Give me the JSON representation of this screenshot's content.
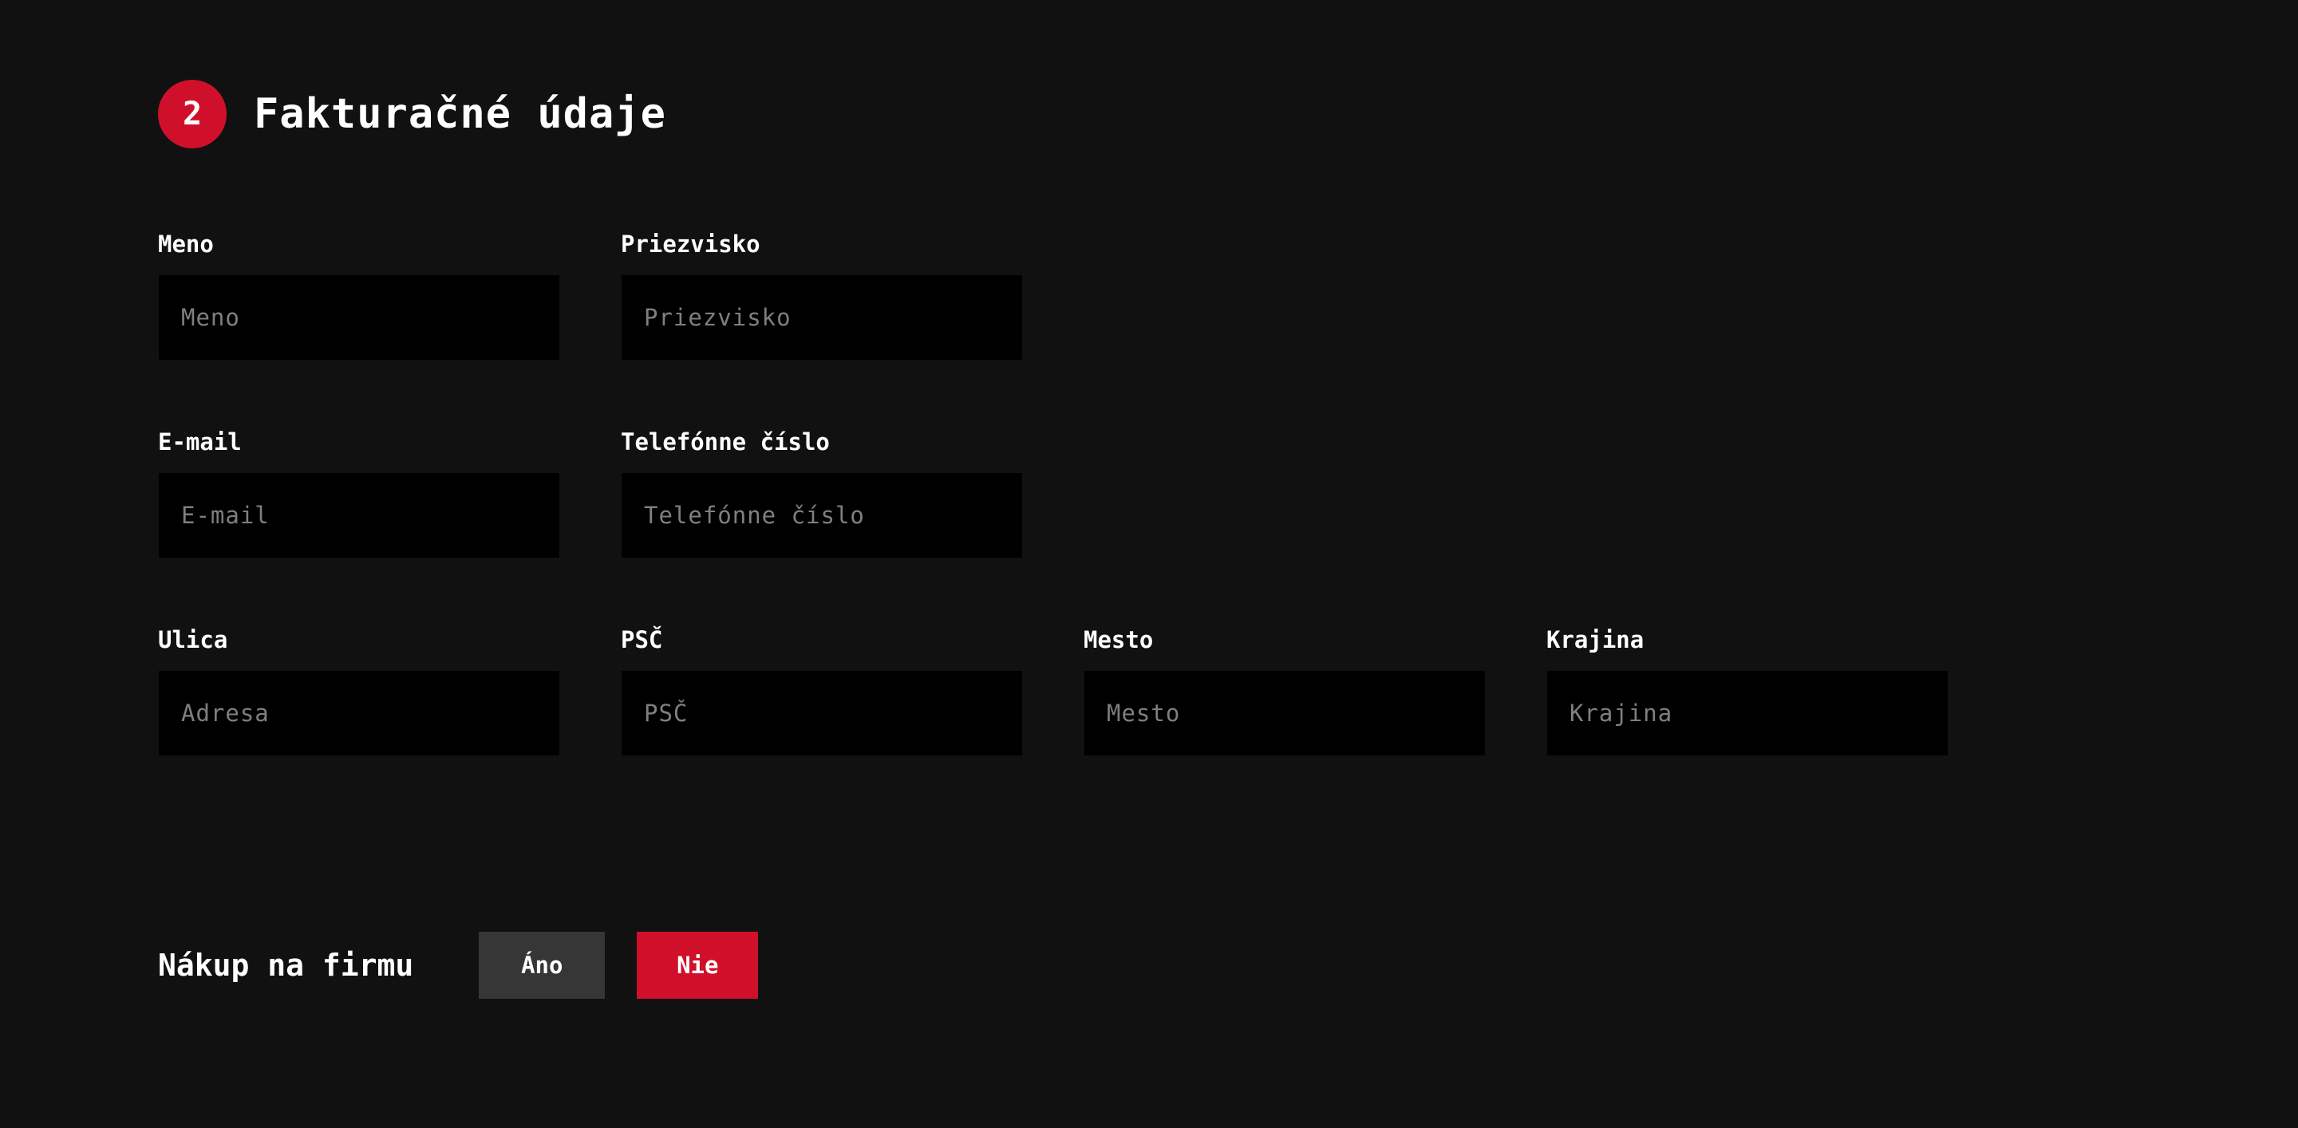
{
  "section": {
    "step_number": "2",
    "title": "Fakturačné údaje"
  },
  "fields": {
    "first_name": {
      "label": "Meno",
      "placeholder": "Meno",
      "value": ""
    },
    "last_name": {
      "label": "Priezvisko",
      "placeholder": "Priezvisko",
      "value": ""
    },
    "email": {
      "label": "E-mail",
      "placeholder": "E-mail",
      "value": ""
    },
    "phone": {
      "label": "Telefónne číslo",
      "placeholder": "Telefónne číslo",
      "value": ""
    },
    "street": {
      "label": "Ulica",
      "placeholder": "Adresa",
      "value": ""
    },
    "zip": {
      "label": "PSČ",
      "placeholder": "PSČ",
      "value": ""
    },
    "city": {
      "label": "Mesto",
      "placeholder": "Mesto",
      "value": ""
    },
    "country": {
      "label": "Krajina",
      "placeholder": "Krajina",
      "value": ""
    }
  },
  "company_purchase": {
    "label": "Nákup na firmu",
    "options": [
      "Áno",
      "Nie"
    ],
    "selected": "Nie"
  },
  "colors": {
    "background": "#111112",
    "accent": "#d0102a",
    "input_bg": "#000000",
    "inactive_button": "#363636",
    "placeholder": "#7f7f7f"
  }
}
